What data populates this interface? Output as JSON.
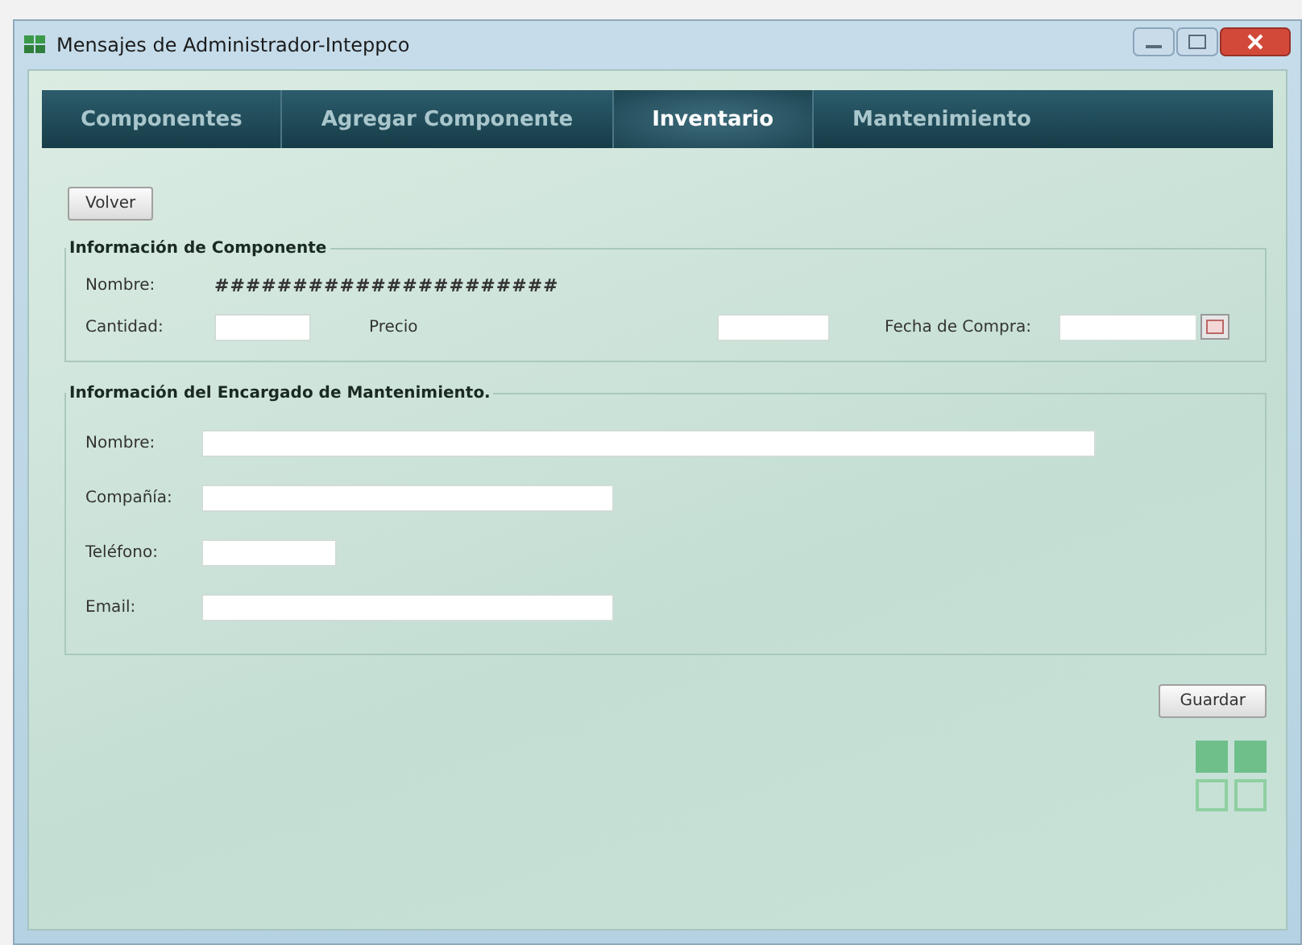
{
  "window": {
    "title": "Mensajes de Administrador-Inteppco"
  },
  "tabs": [
    {
      "label": "Componentes",
      "selected": false
    },
    {
      "label": "Agregar Componente",
      "selected": false
    },
    {
      "label": "Inventario",
      "selected": true
    },
    {
      "label": "Mantenimiento",
      "selected": false
    }
  ],
  "back_button": "Volver",
  "component_info": {
    "title": "Información de Componente",
    "name_label": "Nombre:",
    "name_value": "######################",
    "quantity_label": "Cantidad:",
    "price_label": "Precio",
    "purchase_date_label": "Fecha de Compra:"
  },
  "maintenance_info": {
    "title": "Información del Encargado de Mantenimiento.",
    "fields": [
      {
        "label": "Nombre:"
      },
      {
        "label": "Compañía:"
      },
      {
        "label": "Teléfono:"
      },
      {
        "label": "Email:"
      }
    ]
  },
  "save_button": "Guardar"
}
